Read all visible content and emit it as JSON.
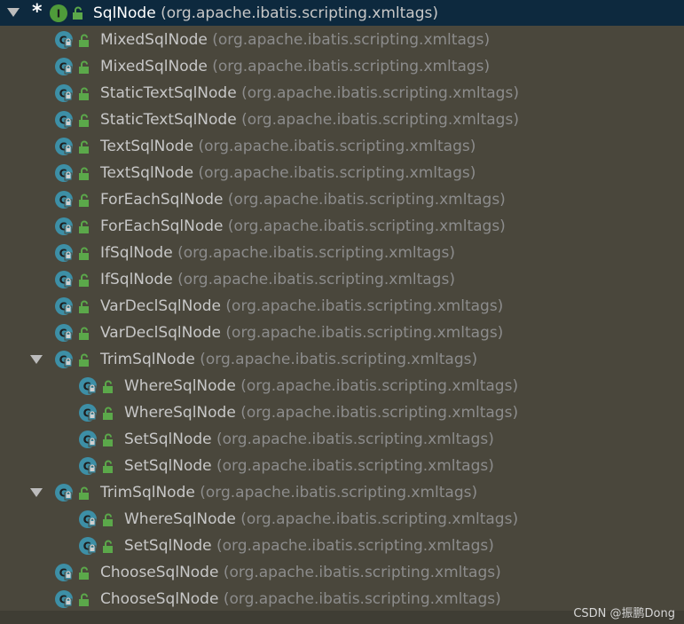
{
  "tree": {
    "root": {
      "name": "SqlNode",
      "package": "(org.apache.ibatis.scripting.xmltags)",
      "marker": "*",
      "icon": "interface-icon",
      "expanded": true
    },
    "rows": [
      {
        "name": "MixedSqlNode",
        "package": "(org.apache.ibatis.scripting.xmltags)",
        "level": 1
      },
      {
        "name": "MixedSqlNode",
        "package": "(org.apache.ibatis.scripting.xmltags)",
        "level": 1
      },
      {
        "name": "StaticTextSqlNode",
        "package": "(org.apache.ibatis.scripting.xmltags)",
        "level": 1
      },
      {
        "name": "StaticTextSqlNode",
        "package": "(org.apache.ibatis.scripting.xmltags)",
        "level": 1
      },
      {
        "name": "TextSqlNode",
        "package": "(org.apache.ibatis.scripting.xmltags)",
        "level": 1
      },
      {
        "name": "TextSqlNode",
        "package": "(org.apache.ibatis.scripting.xmltags)",
        "level": 1
      },
      {
        "name": "ForEachSqlNode",
        "package": "(org.apache.ibatis.scripting.xmltags)",
        "level": 1
      },
      {
        "name": "ForEachSqlNode",
        "package": "(org.apache.ibatis.scripting.xmltags)",
        "level": 1
      },
      {
        "name": "IfSqlNode",
        "package": "(org.apache.ibatis.scripting.xmltags)",
        "level": 1
      },
      {
        "name": "IfSqlNode",
        "package": "(org.apache.ibatis.scripting.xmltags)",
        "level": 1
      },
      {
        "name": "VarDeclSqlNode",
        "package": "(org.apache.ibatis.scripting.xmltags)",
        "level": 1
      },
      {
        "name": "VarDeclSqlNode",
        "package": "(org.apache.ibatis.scripting.xmltags)",
        "level": 1
      },
      {
        "name": "TrimSqlNode",
        "package": "(org.apache.ibatis.scripting.xmltags)",
        "level": 1,
        "expanded": true
      },
      {
        "name": "WhereSqlNode",
        "package": "(org.apache.ibatis.scripting.xmltags)",
        "level": 2
      },
      {
        "name": "WhereSqlNode",
        "package": "(org.apache.ibatis.scripting.xmltags)",
        "level": 2
      },
      {
        "name": "SetSqlNode",
        "package": "(org.apache.ibatis.scripting.xmltags)",
        "level": 2
      },
      {
        "name": "SetSqlNode",
        "package": "(org.apache.ibatis.scripting.xmltags)",
        "level": 2
      },
      {
        "name": "TrimSqlNode",
        "package": "(org.apache.ibatis.scripting.xmltags)",
        "level": 1,
        "expanded": true
      },
      {
        "name": "WhereSqlNode",
        "package": "(org.apache.ibatis.scripting.xmltags)",
        "level": 2
      },
      {
        "name": "SetSqlNode",
        "package": "(org.apache.ibatis.scripting.xmltags)",
        "level": 2
      },
      {
        "name": "ChooseSqlNode",
        "package": "(org.apache.ibatis.scripting.xmltags)",
        "level": 1
      },
      {
        "name": "ChooseSqlNode",
        "package": "(org.apache.ibatis.scripting.xmltags)",
        "level": 1
      }
    ]
  },
  "watermark": "CSDN @振鹏Dong",
  "colors": {
    "background": "#4a473c",
    "selected_row": "#0d293e",
    "class_icon": "#3d8fa6",
    "interface_icon": "#4f9b3a",
    "lock": "#5ba84a"
  }
}
